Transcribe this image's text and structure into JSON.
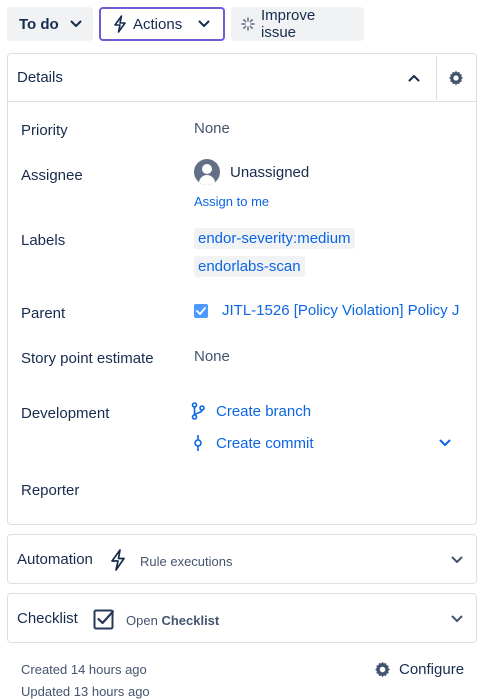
{
  "toolbar": {
    "status_label": "To do",
    "actions_label": "Actions",
    "improve_label": "Improve issue"
  },
  "details": {
    "title": "Details",
    "fields": {
      "priority": {
        "label": "Priority",
        "value": "None"
      },
      "assignee": {
        "label": "Assignee",
        "value": "Unassigned",
        "assign_link": "Assign to me"
      },
      "labels": {
        "label": "Labels",
        "values": [
          "endor-severity:medium",
          "endorlabs-scan"
        ]
      },
      "parent": {
        "label": "Parent",
        "value": "JITL-1526 [Policy Violation] Policy J"
      },
      "story_points": {
        "label": "Story point estimate",
        "value": "None"
      },
      "development": {
        "label": "Development",
        "create_branch": "Create branch",
        "create_commit": "Create commit"
      },
      "reporter": {
        "label": "Reporter"
      }
    }
  },
  "automation": {
    "title": "Automation",
    "subtitle": "Rule executions"
  },
  "checklist": {
    "title": "Checklist",
    "open_prefix": "Open",
    "open_bold": "Checklist"
  },
  "footer": {
    "created": "Created 14 hours ago",
    "updated": "Updated 13 hours ago",
    "configure_label": "Configure"
  },
  "colors": {
    "accent": "#6b5fd8",
    "link": "#0c66e4",
    "text": "#172b4d",
    "subtle": "#44546f",
    "border": "#dcdfe4"
  }
}
